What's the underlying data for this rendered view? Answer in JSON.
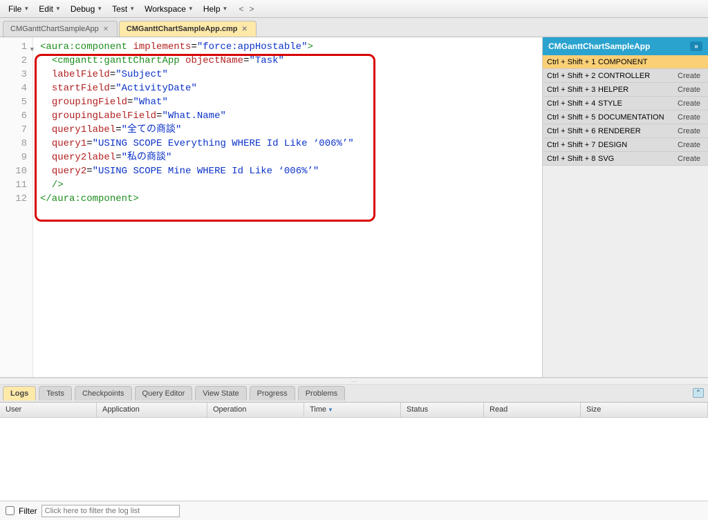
{
  "menu": {
    "items": [
      "File",
      "Edit",
      "Debug",
      "Test",
      "Workspace",
      "Help"
    ]
  },
  "tabs": [
    {
      "label": "CMGanttChartSampleApp",
      "active": false
    },
    {
      "label": "CMGanttChartSampleApp.cmp",
      "active": true
    }
  ],
  "gutter": [
    "1",
    "2",
    "3",
    "4",
    "5",
    "6",
    "7",
    "8",
    "9",
    "10",
    "11",
    "12"
  ],
  "code": {
    "l1a": "<aura:component",
    "l1b": "implements",
    "l1c": "=",
    "l1d": "\"force:appHostable\"",
    "l1e": ">",
    "l2a": "<cmgantt:ganttChartApp",
    "l2b": "objectName",
    "l2c": "\"Task\"",
    "l3a": "labelField",
    "l3b": "\"Subject\"",
    "l4a": "startField",
    "l4b": "\"ActivityDate\"",
    "l5a": "groupingField",
    "l5b": "\"What\"",
    "l6a": "groupingLabelField",
    "l6b": "\"What.Name\"",
    "l7a": "query1label",
    "l7b": "\"全ての商談\"",
    "l8a": "query1",
    "l8b": "\"USING SCOPE Everything WHERE Id Like ‘006%’\"",
    "l9a": "query2label",
    "l9b": "\"私の商談\"",
    "l10a": "query2",
    "l10b": "\"USING SCOPE Mine WHERE Id Like ‘006%’\"",
    "l11": "/>",
    "l12": "</aura:component>",
    "eq": "="
  },
  "side": {
    "title": "CMGanttChartSampleApp",
    "rows": [
      {
        "key": "Ctrl + Shift + 1",
        "name": "COMPONENT",
        "create": ""
      },
      {
        "key": "Ctrl + Shift + 2",
        "name": "CONTROLLER",
        "create": "Create"
      },
      {
        "key": "Ctrl + Shift + 3",
        "name": "HELPER",
        "create": "Create"
      },
      {
        "key": "Ctrl + Shift + 4",
        "name": "STYLE",
        "create": "Create"
      },
      {
        "key": "Ctrl + Shift + 5",
        "name": "DOCUMENTATION",
        "create": "Create"
      },
      {
        "key": "Ctrl + Shift + 6",
        "name": "RENDERER",
        "create": "Create"
      },
      {
        "key": "Ctrl + Shift + 7",
        "name": "DESIGN",
        "create": "Create"
      },
      {
        "key": "Ctrl + Shift + 8",
        "name": "SVG",
        "create": "Create"
      }
    ]
  },
  "panelTabs": [
    "Logs",
    "Tests",
    "Checkpoints",
    "Query Editor",
    "View State",
    "Progress",
    "Problems"
  ],
  "panelActive": 0,
  "logCols": {
    "user": "User",
    "app": "Application",
    "op": "Operation",
    "time": "Time",
    "status": "Status",
    "read": "Read",
    "size": "Size"
  },
  "filter": {
    "label": "Filter",
    "placeholder": "Click here to filter the log list"
  }
}
